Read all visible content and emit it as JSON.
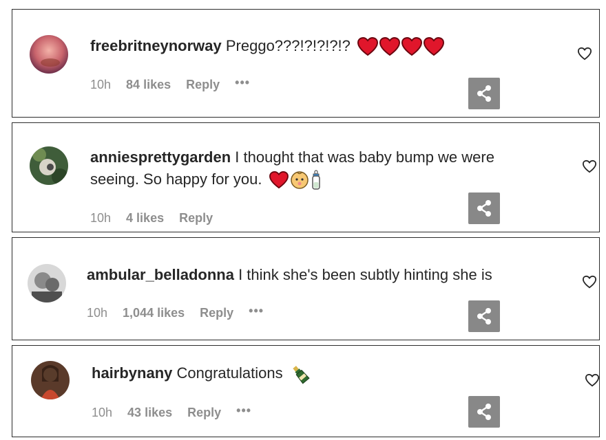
{
  "comments": [
    {
      "username": "freebritneynorway",
      "text": "Preggo???!?!?!?!?",
      "emojis": [
        "red-heart",
        "red-heart",
        "red-heart",
        "red-heart"
      ],
      "time": "10h",
      "likes": "84 likes",
      "reply": "Reply",
      "more": "•••"
    },
    {
      "username": "anniesprettygarden",
      "text": "I thought that was baby bump we were",
      "text_line2": "seeing. So happy for you.",
      "emojis": [
        "red-heart",
        "baby-face",
        "baby-bottle"
      ],
      "time": "10h",
      "likes": "4 likes",
      "reply": "Reply"
    },
    {
      "username": "ambular_belladonna",
      "text": "I think she's been subtly hinting she is",
      "time": "10h",
      "likes": "1,044 likes",
      "reply": "Reply",
      "more": "•••"
    },
    {
      "username": "hairbynany",
      "text": "Congratulations",
      "emojis": [
        "champagne-bottle"
      ],
      "time": "10h",
      "likes": "43 likes",
      "reply": "Reply",
      "more": "•••"
    }
  ],
  "colors": {
    "text": "#262626",
    "meta": "#8e8e8e",
    "heart_emoji": "#e0162b",
    "share_bg": "#888888",
    "border": "#2b2b2b"
  }
}
